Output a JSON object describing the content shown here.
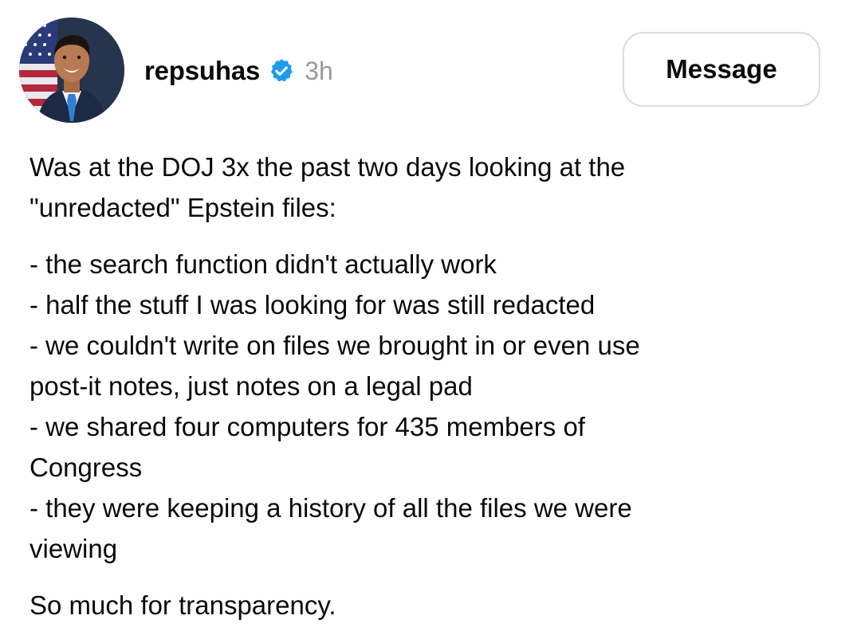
{
  "post": {
    "author": {
      "username": "repsuhas",
      "verified_icon": "verified-badge-icon",
      "timestamp": "3h",
      "avatar": "profile-photo"
    },
    "actions": {
      "message_label": "Message"
    },
    "body": {
      "intro": [
        "Was at the DOJ 3x the past two days looking at the",
        "\"unredacted\" Epstein files:"
      ],
      "bullets": [
        "- the search function didn't actually work",
        "- half the stuff I was looking for was still redacted",
        "- we couldn't write on files we brought in or even use",
        "post-it notes, just notes on a legal pad",
        "- we shared four computers for 435 members of",
        "Congress",
        "- they were keeping a history of all the files we were",
        "viewing"
      ],
      "closing": [
        "So much for transparency."
      ]
    }
  },
  "colors": {
    "verified_blue": "#1d9bf0",
    "muted_text": "#9a9a9a",
    "button_border": "#dbdbdb"
  }
}
